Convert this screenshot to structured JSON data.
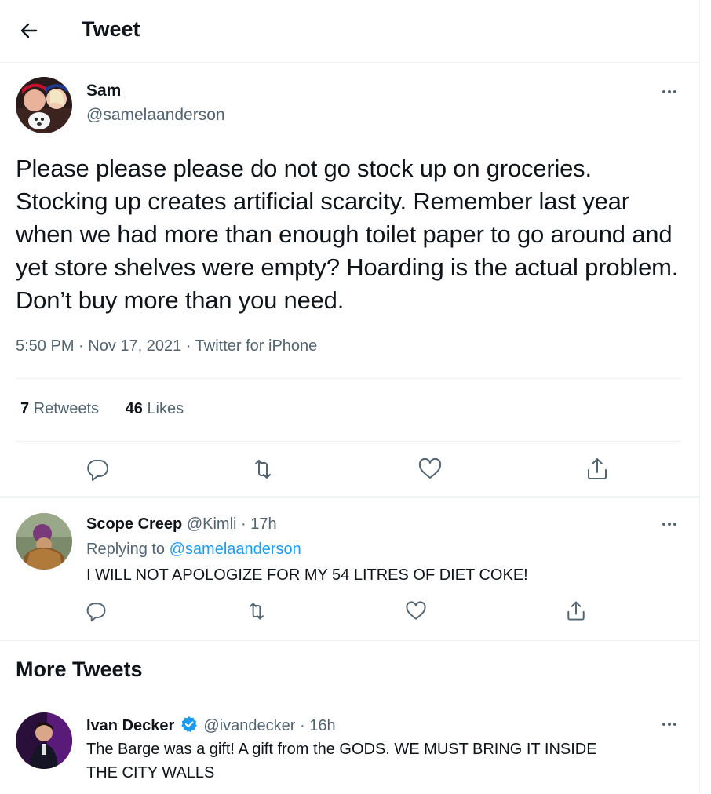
{
  "header": {
    "title": "Tweet"
  },
  "main_tweet": {
    "name": "Sam",
    "handle": "@samelaanderson",
    "text": "Please please please do not go stock up on groceries. Stocking up creates artificial scarcity. Remember last year when we had more than enough toilet paper to go around and yet store shelves were empty? Hoarding is the actual problem. Don’t buy more than you need.",
    "time": "5:50 PM",
    "date": "Nov 17, 2021",
    "source": "Twitter for iPhone",
    "retweets_count": "7",
    "retweets_label": "Retweets",
    "likes_count": "46",
    "likes_label": "Likes"
  },
  "reply": {
    "name": "Scope Creep",
    "handle": "@Kimli",
    "time": "17h",
    "replying_prefix": "Replying to",
    "replying_to": "@samelaanderson",
    "text": "I WILL NOT APOLOGIZE FOR MY 54 LITRES OF DIET COKE!"
  },
  "more_tweets": {
    "title": "More Tweets",
    "items": [
      {
        "name": "Ivan Decker",
        "verified": true,
        "handle": "@ivandecker",
        "time": "16h",
        "text_line1": "The Barge was a gift! A gift from the GODS. WE MUST BRING IT INSIDE",
        "text_line2": "THE CITY WALLS"
      }
    ]
  },
  "colors": {
    "accent": "#1d9bf0",
    "muted": "#536471",
    "text": "#0f1419",
    "border": "#eff3f4"
  },
  "icons": [
    "back-arrow-icon",
    "more-icon",
    "reply-icon",
    "retweet-icon",
    "like-icon",
    "share-icon",
    "verified-badge-icon"
  ]
}
